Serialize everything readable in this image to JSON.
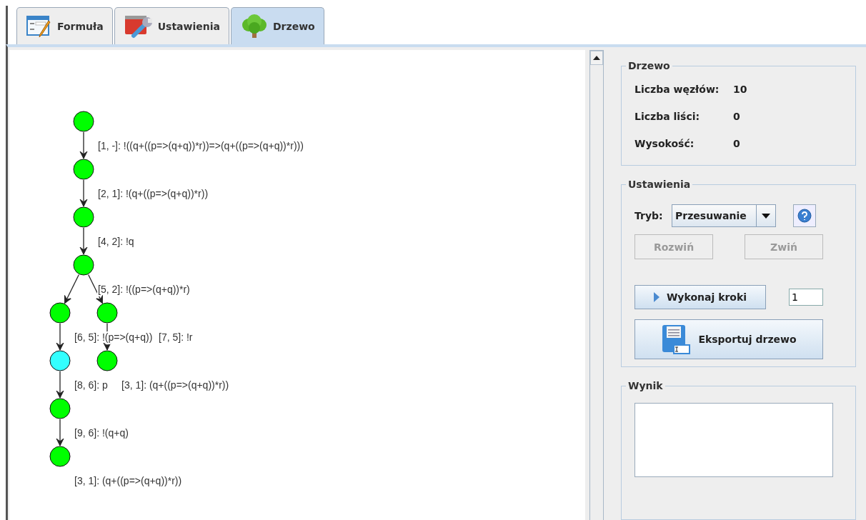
{
  "tabs": [
    {
      "label": "Formuła",
      "selected": false
    },
    {
      "label": "Ustawienia",
      "selected": false
    },
    {
      "label": "Drzewo",
      "selected": true
    }
  ],
  "tree": {
    "label": "[1, -]: !((q+((p=>(q+q))*r))=>(q+((p=>(q+q))*r)))",
    "color": "#00ff00",
    "children": [
      {
        "label": "[2, 1]: !(q+((p=>(q+q))*r))",
        "color": "#00ff00",
        "children": [
          {
            "label": "[4, 2]: !q",
            "color": "#00ff00",
            "children": [
              {
                "label": "[5, 2]: !((p=>(q+q))*r)",
                "color": "#00ff00",
                "children": [
                  {
                    "label": "[6, 5]: !(p=>(q+q))",
                    "color": "#00ff00",
                    "children": [
                      {
                        "label": "[8, 6]: p",
                        "color": "#33ffff",
                        "children": [
                          {
                            "label": "[9, 6]: !(q+q)",
                            "color": "#00ff00",
                            "children": [
                              {
                                "label": "[3, 1]: (q+((p=>(q+q))*r))",
                                "color": "#00ff00"
                              }
                            ]
                          }
                        ]
                      }
                    ]
                  },
                  {
                    "label": "[7, 5]: !r",
                    "color": "#00ff00",
                    "children": [
                      {
                        "label": "[3, 1]: (q+((p=>(q+q))*r))",
                        "color": "#00ff00"
                      }
                    ]
                  }
                ]
              }
            ]
          }
        ]
      }
    ]
  },
  "tree_panel": {
    "title": "Drzewo",
    "stats": [
      {
        "label": "Liczba węzłów:",
        "value": "10"
      },
      {
        "label": "Liczba liści:",
        "value": "0"
      },
      {
        "label": "Wysokość:",
        "value": "0"
      }
    ]
  },
  "settings_panel": {
    "title": "Ustawienia",
    "mode_label": "Tryb:",
    "mode_value": "Przesuwanie",
    "expand_button": {
      "label": "Rozwiń",
      "disabled": true
    },
    "collapse_button": {
      "label": "Zwiń",
      "disabled": true
    },
    "step_button": "Wykonaj kroki",
    "steps_value": "1",
    "export_button": "Eksportuj drzewo"
  },
  "result_panel": {
    "title": "Wynik"
  }
}
